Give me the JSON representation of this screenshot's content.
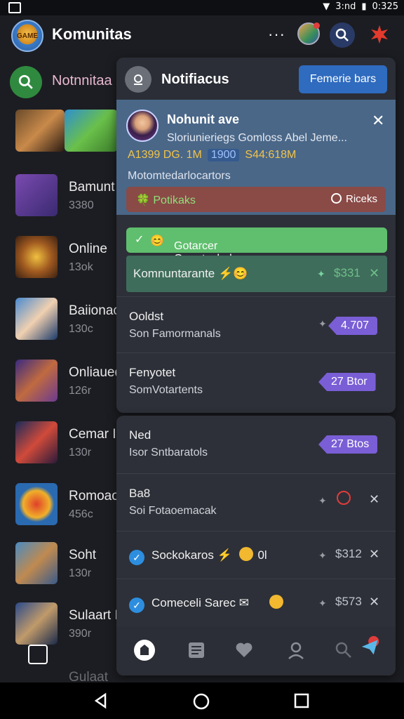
{
  "status": {
    "time": "0:325",
    "network": "3:nd"
  },
  "header": {
    "title": "Komunitas",
    "more": "···",
    "logo_text": "GAME"
  },
  "search": {
    "label": "Notnnitaa"
  },
  "games": [
    {
      "name": "",
      "sub": ""
    },
    {
      "name": "Bamunt",
      "sub": "3380"
    },
    {
      "name": "Online",
      "sub": "13ok"
    },
    {
      "name": "Baiionac",
      "sub": "130c"
    },
    {
      "name": "Onliaued",
      "sub": "126r"
    },
    {
      "name": "Cemar In",
      "sub": "130r"
    },
    {
      "name": "Romoaoe",
      "sub": "456c"
    },
    {
      "name": "Soht",
      "sub": "130r"
    },
    {
      "name": "Sulaart B",
      "sub": "390r"
    },
    {
      "name": "Gulaat",
      "sub": ""
    }
  ],
  "panel": {
    "title": "Notifiacus",
    "action_button": "Femerie bars",
    "card": {
      "title": "Nohunit ave",
      "desc": "Sloriunieriegs Gomloss Abel Jeme...",
      "stat1": "A1399 DG. 1M",
      "stat_pill": "1900",
      "stat2": "S44:618M",
      "line": "Motomtedarlocartors",
      "bar_label": "Potikaks",
      "bar_right": "Riceks"
    },
    "green": "Gotarcer Omertachals",
    "rows": [
      {
        "t1": "Komnuntarante",
        "t2": "",
        "price": "$331"
      },
      {
        "t1": "Ooldst",
        "t2": "Son Famormanals",
        "badge": "4.707"
      },
      {
        "t1": "Fenyotet",
        "t2": "SomVotartents",
        "badge": "27 Btor"
      }
    ]
  },
  "panel2": {
    "rows": [
      {
        "t1": "Ned",
        "t2": "Isor Sntbaratols",
        "badge": "27 Btos"
      },
      {
        "t1": "Ba8",
        "t2": "Soi Fotaoemacak"
      },
      {
        "t1": "Sockokaros",
        "suffix": "0l",
        "price": "$312"
      },
      {
        "t1": "Comeceli Sarec",
        "price": "$573"
      }
    ]
  },
  "colors": {
    "accent": "#2f6bbf",
    "badge": "#7a5ed6",
    "green": "#5fbf6e",
    "card": "#4a6788"
  }
}
